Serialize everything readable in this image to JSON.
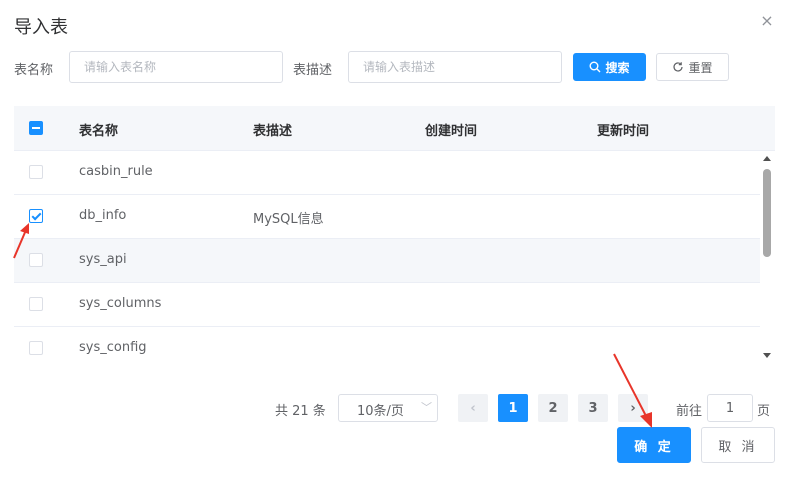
{
  "dialog": {
    "title": "导入表",
    "close_icon": "×"
  },
  "search": {
    "table_name_label": "表名称",
    "table_name_placeholder": "请输入表名称",
    "table_desc_label": "表描述",
    "table_desc_placeholder": "请输入表描述",
    "search_button": "搜索",
    "reset_button": "重置"
  },
  "table": {
    "columns": [
      "表名称",
      "表描述",
      "创建时间",
      "更新时间"
    ],
    "rows": [
      {
        "name": "casbin_rule",
        "desc": "",
        "created": "",
        "updated": "",
        "checked": false
      },
      {
        "name": "db_info",
        "desc": "MySQL信息",
        "created": "",
        "updated": "",
        "checked": true
      },
      {
        "name": "sys_api",
        "desc": "",
        "created": "",
        "updated": "",
        "checked": false
      },
      {
        "name": "sys_columns",
        "desc": "",
        "created": "",
        "updated": "",
        "checked": false
      },
      {
        "name": "sys_config",
        "desc": "",
        "created": "",
        "updated": "",
        "checked": false
      }
    ]
  },
  "pagination": {
    "total_text": "共 21 条",
    "page_size": "10条/页",
    "pages": [
      "1",
      "2",
      "3"
    ],
    "current_page": "1",
    "goto_prefix": "前往",
    "goto_value": "1",
    "goto_suffix": "页",
    "prev_icon": "‹",
    "next_icon": "›"
  },
  "footer": {
    "confirm_button": "确 定",
    "cancel_button": "取 消"
  },
  "colors": {
    "primary": "#1890ff",
    "annotation_arrow": "#e8352a"
  }
}
